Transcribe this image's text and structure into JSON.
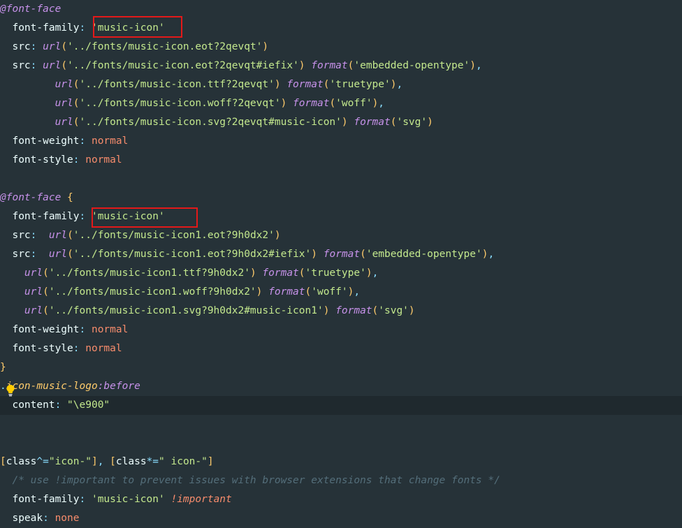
{
  "editor": {
    "highlight_color": "#e31919",
    "colors": {
      "background": "#263238",
      "active_line": "#1f292e",
      "at_rule": "#c792ea",
      "selector": "#ffcb6b",
      "property": "#eeffff",
      "string": "#c3e88d",
      "function": "#c792ea",
      "bracket": "#ffcb6b",
      "value": "#f78c6c",
      "comment": "#546e7a",
      "punctuation": "#89ddff"
    },
    "lines": [
      {
        "tokens": [
          {
            "t": "@font-face",
            "c": "#c792ea",
            "i": true
          }
        ]
      },
      {
        "tokens": [
          {
            "t": "  font-family",
            "c": "#eeffff"
          },
          {
            "t": ": ",
            "c": "#89ddff"
          },
          {
            "t": "'music-icon'",
            "c": "#c3e88d"
          }
        ]
      },
      {
        "tokens": [
          {
            "t": "  src",
            "c": "#eeffff"
          },
          {
            "t": ": ",
            "c": "#89ddff"
          },
          {
            "t": "url",
            "c": "#c792ea",
            "i": true
          },
          {
            "t": "(",
            "c": "#ffcb6b"
          },
          {
            "t": "'../fonts/music-icon.eot?2qevqt'",
            "c": "#c3e88d"
          },
          {
            "t": ")",
            "c": "#ffcb6b"
          }
        ]
      },
      {
        "tokens": [
          {
            "t": "  src",
            "c": "#eeffff"
          },
          {
            "t": ": ",
            "c": "#89ddff"
          },
          {
            "t": "url",
            "c": "#c792ea",
            "i": true
          },
          {
            "t": "(",
            "c": "#ffcb6b"
          },
          {
            "t": "'../fonts/music-icon.eot?2qevqt#iefix'",
            "c": "#c3e88d"
          },
          {
            "t": ")",
            "c": "#ffcb6b"
          },
          {
            "t": " format",
            "c": "#c792ea",
            "i": true
          },
          {
            "t": "(",
            "c": "#ffcb6b"
          },
          {
            "t": "'embedded-opentype'",
            "c": "#c3e88d"
          },
          {
            "t": ")",
            "c": "#ffcb6b"
          },
          {
            "t": ",",
            "c": "#89ddff"
          }
        ]
      },
      {
        "tokens": [
          {
            "t": "         url",
            "c": "#c792ea",
            "i": true
          },
          {
            "t": "(",
            "c": "#ffcb6b"
          },
          {
            "t": "'../fonts/music-icon.ttf?2qevqt'",
            "c": "#c3e88d"
          },
          {
            "t": ")",
            "c": "#ffcb6b"
          },
          {
            "t": " format",
            "c": "#c792ea",
            "i": true
          },
          {
            "t": "(",
            "c": "#ffcb6b"
          },
          {
            "t": "'truetype'",
            "c": "#c3e88d"
          },
          {
            "t": ")",
            "c": "#ffcb6b"
          },
          {
            "t": ",",
            "c": "#89ddff"
          }
        ]
      },
      {
        "tokens": [
          {
            "t": "         url",
            "c": "#c792ea",
            "i": true
          },
          {
            "t": "(",
            "c": "#ffcb6b"
          },
          {
            "t": "'../fonts/music-icon.woff?2qevqt'",
            "c": "#c3e88d"
          },
          {
            "t": ")",
            "c": "#ffcb6b"
          },
          {
            "t": " format",
            "c": "#c792ea",
            "i": true
          },
          {
            "t": "(",
            "c": "#ffcb6b"
          },
          {
            "t": "'woff'",
            "c": "#c3e88d"
          },
          {
            "t": ")",
            "c": "#ffcb6b"
          },
          {
            "t": ",",
            "c": "#89ddff"
          }
        ]
      },
      {
        "tokens": [
          {
            "t": "         url",
            "c": "#c792ea",
            "i": true
          },
          {
            "t": "(",
            "c": "#ffcb6b"
          },
          {
            "t": "'../fonts/music-icon.svg?2qevqt#music-icon'",
            "c": "#c3e88d"
          },
          {
            "t": ")",
            "c": "#ffcb6b"
          },
          {
            "t": " format",
            "c": "#c792ea",
            "i": true
          },
          {
            "t": "(",
            "c": "#ffcb6b"
          },
          {
            "t": "'svg'",
            "c": "#c3e88d"
          },
          {
            "t": ")",
            "c": "#ffcb6b"
          }
        ]
      },
      {
        "tokens": [
          {
            "t": "  font-weight",
            "c": "#eeffff"
          },
          {
            "t": ": ",
            "c": "#89ddff"
          },
          {
            "t": "normal",
            "c": "#f78c6c"
          }
        ]
      },
      {
        "tokens": [
          {
            "t": "  font-style",
            "c": "#eeffff"
          },
          {
            "t": ": ",
            "c": "#89ddff"
          },
          {
            "t": "normal",
            "c": "#f78c6c"
          }
        ]
      },
      {
        "tokens": []
      },
      {
        "tokens": [
          {
            "t": "@font-face",
            "c": "#c792ea",
            "i": true
          },
          {
            "t": " {",
            "c": "#ffcb6b"
          }
        ]
      },
      {
        "tokens": [
          {
            "t": "  font-family",
            "c": "#eeffff"
          },
          {
            "t": ": ",
            "c": "#89ddff"
          },
          {
            "t": "'music-icon'",
            "c": "#c3e88d"
          }
        ]
      },
      {
        "tokens": [
          {
            "t": "  src",
            "c": "#eeffff"
          },
          {
            "t": ":  ",
            "c": "#89ddff"
          },
          {
            "t": "url",
            "c": "#c792ea",
            "i": true
          },
          {
            "t": "(",
            "c": "#ffcb6b"
          },
          {
            "t": "'../fonts/music-icon1.eot?9h0dx2'",
            "c": "#c3e88d"
          },
          {
            "t": ")",
            "c": "#ffcb6b"
          }
        ]
      },
      {
        "tokens": [
          {
            "t": "  src",
            "c": "#eeffff"
          },
          {
            "t": ":  ",
            "c": "#89ddff"
          },
          {
            "t": "url",
            "c": "#c792ea",
            "i": true
          },
          {
            "t": "(",
            "c": "#ffcb6b"
          },
          {
            "t": "'../fonts/music-icon1.eot?9h0dx2#iefix'",
            "c": "#c3e88d"
          },
          {
            "t": ")",
            "c": "#ffcb6b"
          },
          {
            "t": " format",
            "c": "#c792ea",
            "i": true
          },
          {
            "t": "(",
            "c": "#ffcb6b"
          },
          {
            "t": "'embedded-opentype'",
            "c": "#c3e88d"
          },
          {
            "t": ")",
            "c": "#ffcb6b"
          },
          {
            "t": ",",
            "c": "#89ddff"
          }
        ]
      },
      {
        "tokens": [
          {
            "t": "    url",
            "c": "#c792ea",
            "i": true
          },
          {
            "t": "(",
            "c": "#ffcb6b"
          },
          {
            "t": "'../fonts/music-icon1.ttf?9h0dx2'",
            "c": "#c3e88d"
          },
          {
            "t": ")",
            "c": "#ffcb6b"
          },
          {
            "t": " format",
            "c": "#c792ea",
            "i": true
          },
          {
            "t": "(",
            "c": "#ffcb6b"
          },
          {
            "t": "'truetype'",
            "c": "#c3e88d"
          },
          {
            "t": ")",
            "c": "#ffcb6b"
          },
          {
            "t": ",",
            "c": "#89ddff"
          }
        ]
      },
      {
        "tokens": [
          {
            "t": "    url",
            "c": "#c792ea",
            "i": true
          },
          {
            "t": "(",
            "c": "#ffcb6b"
          },
          {
            "t": "'../fonts/music-icon1.woff?9h0dx2'",
            "c": "#c3e88d"
          },
          {
            "t": ")",
            "c": "#ffcb6b"
          },
          {
            "t": " format",
            "c": "#c792ea",
            "i": true
          },
          {
            "t": "(",
            "c": "#ffcb6b"
          },
          {
            "t": "'woff'",
            "c": "#c3e88d"
          },
          {
            "t": ")",
            "c": "#ffcb6b"
          },
          {
            "t": ",",
            "c": "#89ddff"
          }
        ]
      },
      {
        "tokens": [
          {
            "t": "    url",
            "c": "#c792ea",
            "i": true
          },
          {
            "t": "(",
            "c": "#ffcb6b"
          },
          {
            "t": "'../fonts/music-icon1.svg?9h0dx2#music-icon1'",
            "c": "#c3e88d"
          },
          {
            "t": ")",
            "c": "#ffcb6b"
          },
          {
            "t": " format",
            "c": "#c792ea",
            "i": true
          },
          {
            "t": "(",
            "c": "#ffcb6b"
          },
          {
            "t": "'svg'",
            "c": "#c3e88d"
          },
          {
            "t": ")",
            "c": "#ffcb6b"
          }
        ]
      },
      {
        "tokens": [
          {
            "t": "  font-weight",
            "c": "#eeffff"
          },
          {
            "t": ": ",
            "c": "#89ddff"
          },
          {
            "t": "normal",
            "c": "#f78c6c"
          }
        ]
      },
      {
        "tokens": [
          {
            "t": "  font-style",
            "c": "#eeffff"
          },
          {
            "t": ": ",
            "c": "#89ddff"
          },
          {
            "t": "normal",
            "c": "#f78c6c"
          }
        ]
      },
      {
        "tokens": [
          {
            "t": "}",
            "c": "#ffcb6b"
          }
        ]
      },
      {
        "tokens": [
          {
            "t": ".",
            "c": "#89ddff"
          },
          {
            "t": "icon-music-logo",
            "c": "#ffcb6b",
            "i": true
          },
          {
            "t": ":before",
            "c": "#c792ea",
            "i": true
          }
        ]
      },
      {
        "tokens": [
          {
            "t": "  content",
            "c": "#eeffff"
          },
          {
            "t": ": ",
            "c": "#89ddff"
          },
          {
            "t": "\"\\e900\"",
            "c": "#c3e88d"
          }
        ],
        "active": true
      },
      {
        "tokens": []
      },
      {
        "tokens": []
      },
      {
        "tokens": [
          {
            "t": "[",
            "c": "#ffcb6b"
          },
          {
            "t": "class",
            "c": "#eeffff"
          },
          {
            "t": "^=",
            "c": "#89ddff"
          },
          {
            "t": "\"icon-\"",
            "c": "#c3e88d"
          },
          {
            "t": "]",
            "c": "#ffcb6b"
          },
          {
            "t": ", ",
            "c": "#89ddff"
          },
          {
            "t": "[",
            "c": "#ffcb6b"
          },
          {
            "t": "class",
            "c": "#eeffff"
          },
          {
            "t": "*=",
            "c": "#89ddff"
          },
          {
            "t": "\" icon-\"",
            "c": "#c3e88d"
          },
          {
            "t": "]",
            "c": "#ffcb6b"
          }
        ]
      },
      {
        "tokens": [
          {
            "t": "  /* use !important to prevent issues with browser extensions that change fonts */",
            "c": "#546e7a",
            "i": true
          }
        ]
      },
      {
        "tokens": [
          {
            "t": "  font-family",
            "c": "#eeffff"
          },
          {
            "t": ": ",
            "c": "#89ddff"
          },
          {
            "t": "'music-icon'",
            "c": "#c3e88d"
          },
          {
            "t": " !important",
            "c": "#f78c6c",
            "i": true
          }
        ]
      },
      {
        "tokens": [
          {
            "t": "  speak",
            "c": "#eeffff"
          },
          {
            "t": ": ",
            "c": "#89ddff"
          },
          {
            "t": "none",
            "c": "#f78c6c"
          }
        ]
      }
    ]
  }
}
